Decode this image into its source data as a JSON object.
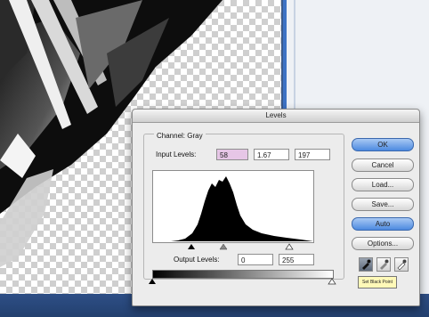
{
  "dialog": {
    "title": "Levels",
    "channel_label": "Channel:",
    "channel_value": "Gray",
    "input_levels_label": "Input Levels:",
    "input_black": "58",
    "input_gamma": "1.67",
    "input_white": "197",
    "output_levels_label": "Output Levels:",
    "output_black": "0",
    "output_white": "255",
    "buttons": {
      "ok": "OK",
      "cancel": "Cancel",
      "load": "Load...",
      "save": "Save...",
      "auto": "Auto",
      "options": "Options..."
    },
    "tooltip": "Set Black Point"
  },
  "icons": {
    "black_eyedropper": "eyedropper-black-icon",
    "gray_eyedropper": "eyedropper-gray-icon",
    "white_eyedropper": "eyedropper-white-icon"
  },
  "colors": {
    "accent": "#4c8ae0",
    "selection": "#e6c6e6"
  }
}
